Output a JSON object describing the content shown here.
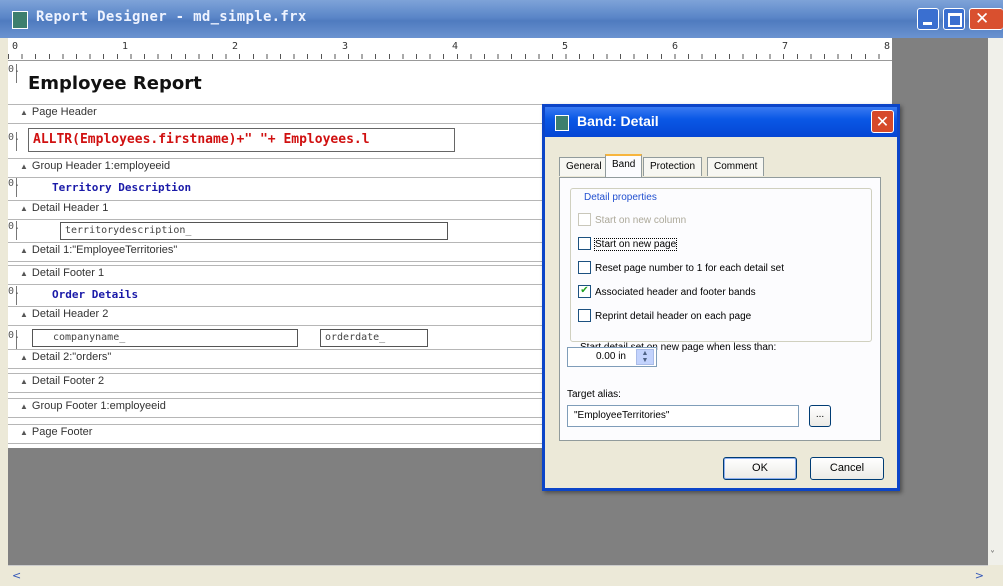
{
  "window": {
    "title": "Report Designer - md_simple.frx"
  },
  "ruler": {
    "marks": [
      "0",
      "1",
      "2",
      "3",
      "4",
      "5",
      "6",
      "7",
      "8"
    ]
  },
  "report": {
    "heading": "Employee Report",
    "zero": "0.",
    "bands": {
      "page_header": "Page Header",
      "group_header": "Group Header 1:employeeid",
      "detail_header_1": "Detail Header 1",
      "detail_1": "Detail 1:\"EmployeeTerritories\"",
      "detail_footer_1": "Detail Footer 1",
      "detail_header_2": "Detail Header 2",
      "detail_2": "Detail 2:\"orders\"",
      "detail_footer_2": "Detail Footer 2",
      "group_footer": "Group Footer 1:employeeid",
      "page_footer": "Page Footer"
    },
    "expression": "ALLTR(Employees.firstname)+\" \"+ Employees.l",
    "territory_label": "Territory Description",
    "territory_field": "territorydescription_",
    "order_label": "Order Details",
    "company_field": "companyname_",
    "orderdate_field": "orderdate_"
  },
  "dialog": {
    "title": "Band: Detail",
    "tabs": [
      "General",
      "Band",
      "Protection",
      "Comment"
    ],
    "active_tab": "Band",
    "group_label": "Detail properties",
    "options": [
      {
        "label": "Start on new column",
        "checked": false,
        "disabled": true
      },
      {
        "label": "Start on new page",
        "checked": false,
        "disabled": false
      },
      {
        "label": "Reset page number to 1 for each detail set",
        "checked": false,
        "disabled": false
      },
      {
        "label": "Associated header and footer bands",
        "checked": true,
        "disabled": false
      },
      {
        "label": "Reprint detail header on each page",
        "checked": false,
        "disabled": false
      }
    ],
    "threshold_label": "Start detail set on new page when less than:",
    "threshold_value": "0.00 in",
    "target_alias_label": "Target alias:",
    "target_alias_value": "\"EmployeeTerritories\"",
    "ellipsis_label": "...",
    "ok_label": "OK",
    "cancel_label": "Cancel"
  },
  "scroll": {
    "left_arrow": "<",
    "right_arrow": ">",
    "down_arrow": "˅"
  }
}
